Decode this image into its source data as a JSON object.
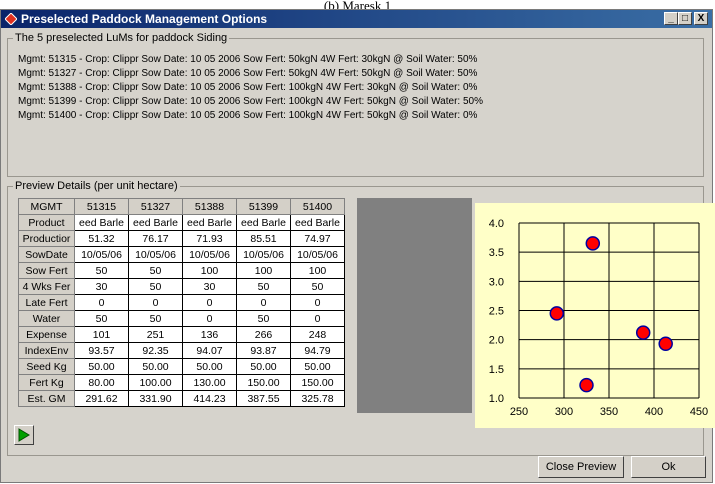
{
  "page_top_text": "(b) Maresk 1",
  "window": {
    "title": "Preselected Paddock Management Options",
    "minimize_label": "_",
    "maximize_label": "□",
    "close_label": "X"
  },
  "luMs": {
    "group_label": "The 5 preselected LuMs for paddock Siding",
    "lines": [
      "Mgmt: 51315 - Crop: Clippr Sow Date: 10 05 2006 Sow Fert: 50kgN 4W Fert: 30kgN @ Soil Water: 50%",
      "Mgmt: 51327 - Crop: Clippr Sow Date: 10 05 2006 Sow Fert: 50kgN 4W Fert: 50kgN @ Soil Water: 50%",
      "Mgmt: 51388 - Crop: Clippr Sow Date: 10 05 2006 Sow Fert: 100kgN 4W Fert: 30kgN @ Soil Water: 0%",
      "Mgmt: 51399 - Crop: Clippr Sow Date: 10 05 2006 Sow Fert: 100kgN 4W Fert: 50kgN @ Soil Water: 50%",
      "Mgmt: 51400 - Crop: Clippr Sow Date: 10 05 2006 Sow Fert: 100kgN 4W Fert: 50kgN @ Soil Water: 0%"
    ]
  },
  "preview": {
    "group_label": "Preview Details (per unit hectare)",
    "header": [
      "MGMT",
      "51315",
      "51327",
      "51388",
      "51399",
      "51400"
    ],
    "rows": [
      [
        "Product",
        "eed Barle",
        "eed Barle",
        "eed Barle",
        "eed Barle",
        "eed Barle"
      ],
      [
        "Productior",
        "51.32",
        "76.17",
        "71.93",
        "85.51",
        "74.97"
      ],
      [
        "SowDate",
        "10/05/06",
        "10/05/06",
        "10/05/06",
        "10/05/06",
        "10/05/06"
      ],
      [
        "Sow Fert",
        "50",
        "50",
        "100",
        "100",
        "100"
      ],
      [
        "4 Wks Fer",
        "30",
        "50",
        "30",
        "50",
        "50"
      ],
      [
        "Late Fert",
        "0",
        "0",
        "0",
        "0",
        "0"
      ],
      [
        "Water",
        "50",
        "50",
        "0",
        "50",
        "0"
      ],
      [
        "Expense",
        "101",
        "251",
        "136",
        "266",
        "248"
      ],
      [
        "IndexEnv",
        "93.57",
        "92.35",
        "94.07",
        "93.87",
        "94.79"
      ],
      [
        "Seed Kg",
        "50.00",
        "50.00",
        "50.00",
        "50.00",
        "50.00"
      ],
      [
        "Fert Kg",
        "80.00",
        "100.00",
        "130.00",
        "150.00",
        "150.00"
      ],
      [
        "Est. GM",
        "291.62",
        "331.90",
        "414.23",
        "387.55",
        "325.78"
      ]
    ]
  },
  "chart_data": {
    "type": "scatter",
    "title": "",
    "xlabel": "",
    "ylabel": "",
    "xlim": [
      250,
      450
    ],
    "ylim": [
      1.0,
      4.0
    ],
    "x_ticks": [
      "250",
      "300",
      "350",
      "400",
      "450"
    ],
    "y_ticks": [
      "1.0",
      "1.5",
      "2.0",
      "2.5",
      "3.0",
      "3.5",
      "4.0"
    ],
    "grid": true,
    "background_color": "#ffffc8",
    "point_color": "#ff0000",
    "series": [
      {
        "x": [
          292,
          332,
          325,
          388,
          413
        ],
        "y": [
          2.45,
          3.65,
          1.22,
          2.12,
          1.93
        ]
      }
    ]
  },
  "buttons": {
    "run_icon": "play-icon",
    "close_preview": "Close Preview",
    "ok": "Ok"
  }
}
